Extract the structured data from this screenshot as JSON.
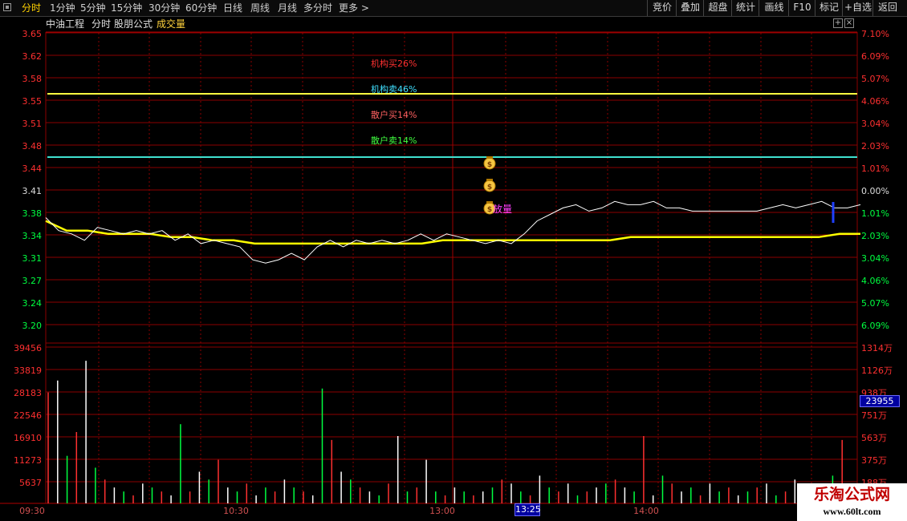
{
  "toolbar": {
    "left_items": [
      "分时",
      "1分钟",
      "5分钟",
      "15分钟",
      "30分钟",
      "60分钟",
      "日线",
      "周线",
      "月线",
      "多分时",
      "更多 >"
    ],
    "active_index": 0,
    "right_items": [
      "竞价",
      "叠加",
      "超盘",
      "统计",
      "画线",
      "F10",
      "标记",
      "+自选",
      "返回"
    ]
  },
  "header": {
    "stock_name": "中油工程",
    "period": "分时",
    "formula_name": "股朋公式",
    "indicator": "成交量"
  },
  "controls": {
    "add_icon": "plus-box-icon",
    "close_icon": "close-box-icon"
  },
  "price_axis": {
    "left_labels": [
      "3.65",
      "3.62",
      "3.58",
      "3.55",
      "3.51",
      "3.48",
      "3.44",
      "3.41",
      "3.38",
      "3.34",
      "3.31",
      "3.27",
      "3.24",
      "3.20"
    ],
    "right_labels": [
      "7.10%",
      "6.09%",
      "5.07%",
      "4.06%",
      "3.04%",
      "2.03%",
      "1.01%",
      "0.00%",
      "1.01%",
      "2.03%",
      "3.04%",
      "4.06%",
      "5.07%",
      "6.09%"
    ],
    "reference_index": 7
  },
  "volume_axis": {
    "left_labels": [
      "39456",
      "33819",
      "28183",
      "22546",
      "16910",
      "11273",
      "5637"
    ],
    "right_labels": [
      "1314万",
      "1126万",
      "938万",
      "751万",
      "563万",
      "375万",
      "188万"
    ],
    "current_volume": "23955"
  },
  "time_axis": {
    "labels": [
      "09:30",
      "10:30",
      "13:00",
      "14:00"
    ],
    "highlight": "13:25"
  },
  "annotations": [
    {
      "text": "机构买26%",
      "color": "#ff3030"
    },
    {
      "text": "机构卖46%",
      "color": "#40e0ff"
    },
    {
      "text": "散户买14%",
      "color": "#ff6060"
    },
    {
      "text": "散户卖14%",
      "color": "#40ff40"
    }
  ],
  "signal": {
    "icon": "money-bag-icon",
    "label": "放量",
    "label_color": "#ff40ff"
  },
  "colors": {
    "up": "#ff3030",
    "down": "#00ff40",
    "grid": "#8b0000",
    "price_line": "#ffffff",
    "avg_line": "#ffff00",
    "buy_level": "#ffff40",
    "sell_level": "#40e0d0"
  },
  "chart_data": {
    "type": "line",
    "x_labels": [
      "09:30",
      "10:30",
      "13:00",
      "14:00"
    ],
    "series": [
      {
        "values": [
          3.365,
          3.345,
          3.34,
          3.33,
          3.35,
          3.345,
          3.34,
          3.345,
          3.34,
          3.345,
          3.33,
          3.34,
          3.325,
          3.33,
          3.325,
          3.32,
          3.3,
          3.295,
          3.3,
          3.31,
          3.3,
          3.32,
          3.33,
          3.32,
          3.33,
          3.325,
          3.33,
          3.325,
          3.33,
          3.34,
          3.33,
          3.34,
          3.335,
          3.33,
          3.325,
          3.33,
          3.325,
          3.34,
          3.36,
          3.37,
          3.38,
          3.385,
          3.375,
          3.38,
          3.39,
          3.385,
          3.385,
          3.39,
          3.38,
          3.38,
          3.375,
          3.375,
          3.375,
          3.375,
          3.375,
          3.375,
          3.38,
          3.385,
          3.38,
          3.385,
          3.39,
          3.38,
          3.38,
          3.385
        ]
      },
      {
        "values": [
          3.36,
          3.345,
          3.345,
          3.34,
          3.34,
          3.34,
          3.335,
          3.335,
          3.33,
          3.33,
          3.325,
          3.325,
          3.325,
          3.325,
          3.325,
          3.325,
          3.325,
          3.325,
          3.325,
          3.33,
          3.33,
          3.33,
          3.33,
          3.33,
          3.33,
          3.33,
          3.33,
          3.33,
          3.335,
          3.335,
          3.335,
          3.335,
          3.335,
          3.335,
          3.335,
          3.335,
          3.335,
          3.335,
          3.34,
          3.34
        ]
      }
    ],
    "volumes": [
      28000,
      31000,
      12000,
      18000,
      36000,
      9000,
      6000,
      4000,
      3000,
      2000,
      5000,
      4000,
      3000,
      2000,
      20000,
      3000,
      8000,
      6000,
      11000,
      4000,
      3000,
      5000,
      2000,
      4000,
      3000,
      6000,
      4000,
      3000,
      2000,
      29000,
      16000,
      8000,
      6000,
      4000,
      3000,
      2000,
      5000,
      17000,
      3000,
      4000,
      11000,
      3000,
      2000,
      4000,
      3000,
      2000,
      3000,
      4000,
      6000,
      5000,
      3000,
      2000,
      7000,
      4000,
      3000,
      5000,
      2000,
      3000,
      4000,
      5000,
      6000,
      4000,
      3000,
      17000,
      2000,
      7000,
      5000,
      3000,
      4000,
      2000,
      5000,
      3000,
      4000,
      2000,
      3000,
      4000,
      5000,
      2000,
      3000,
      6000,
      4000,
      2000,
      3000,
      7000,
      16000,
      3000
    ],
    "ylim": [
      3.18,
      3.66
    ],
    "volume_max": 39456,
    "reference_price": 3.41
  }
}
